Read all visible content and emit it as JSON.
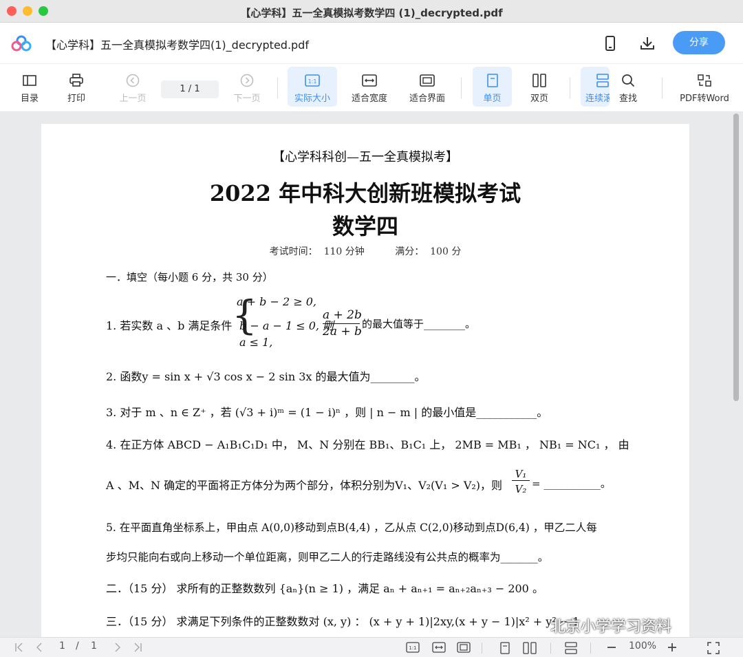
{
  "window": {
    "title": "【心学科】五一全真模拟考数学四 (1)_decrypted.pdf"
  },
  "header": {
    "doc_title": "【心学科】五一全真模拟考数学四(1)_decrypted.pdf",
    "share_label": "分享"
  },
  "toolbar": {
    "toc": "目录",
    "print": "打印",
    "prev": "上一页",
    "page_display": "1 / 1",
    "next": "下一页",
    "actual_size": "实际大小",
    "fit_width": "适合宽度",
    "fit_page": "适合界面",
    "single_page": "单页",
    "double_page": "双页",
    "continuous": "连续滚",
    "find": "查找",
    "pdf_to_word": "PDF转Word"
  },
  "document": {
    "header_line": "【心学科科创—五一全真模拟考】",
    "title": "2022 年中科大创新班模拟考试",
    "subtitle": "数学四",
    "exam_info": "考试时间：  110 分钟          满分：  100 分",
    "section1": "一．填空（每小题 6 分，共 30 分）",
    "q1_cond1": "a + b − 2 ≥ 0,",
    "q1_text": "1.   若实数 a 、b 满足条件",
    "q1_cond2": "b − a − 1 ≤ 0,  则",
    "q1_cond3": "a ≤ 1,",
    "q1_num": "a + 2b",
    "q1_den": "2a + b",
    "q1_tail": "的最大值等于________。",
    "q2": "2.   函数y = sin x + √3 cos x − 2 sin 3x 的最大值为________。",
    "q3": "3.   对于 m 、n ∈ Z⁺ ，若 (√3 + i)ᵐ = (1 − i)ⁿ ，则 | n − m | 的最小值是___________。",
    "q4_line1": "4.   在正方体 ABCD − A₁B₁C₁D₁ 中， M、N 分别在 BB₁、B₁C₁ 上， 2MB = MB₁ ， NB₁ = NC₁ ， 由",
    "q4_line2": "A 、M、N 确定的平面将正方体分为两个部分，体积分别为V₁、V₂(V₁ > V₂)，则",
    "q4_num": "V₁",
    "q4_den": "V₂",
    "q4_tail": "= ___________。",
    "q5_line1": "5.   在平面直角坐标系上，甲由点 A(0,0)移动到点B(4,4) ，乙从点 C(2,0)移动到点D(6,4) ，甲乙二人每",
    "q5_line2": "步均只能向右或向上移动一个单位距离，则甲乙二人的行走路线没有公共点的概率为_______。",
    "section2": "二．（15 分）  求所有的正整数数列 {aₙ}(n ≥ 1) ，满足 aₙ + aₙ₊₁ = aₙ₊₂aₙ₊₃ − 200 。",
    "section3": "三．（15 分）  求满足下列条件的正整数数对 (x, y) ： (x + y + 1)|2xy,(x + y − 1)|x² + y² − 1"
  },
  "statusbar": {
    "page_current": "1",
    "page_sep": "/",
    "page_total": "1",
    "zoom": "100%"
  },
  "watermark": "北京小学学习资料",
  "colors": {
    "accent": "#4a9bf5",
    "active_bg": "#e7f1fd"
  }
}
